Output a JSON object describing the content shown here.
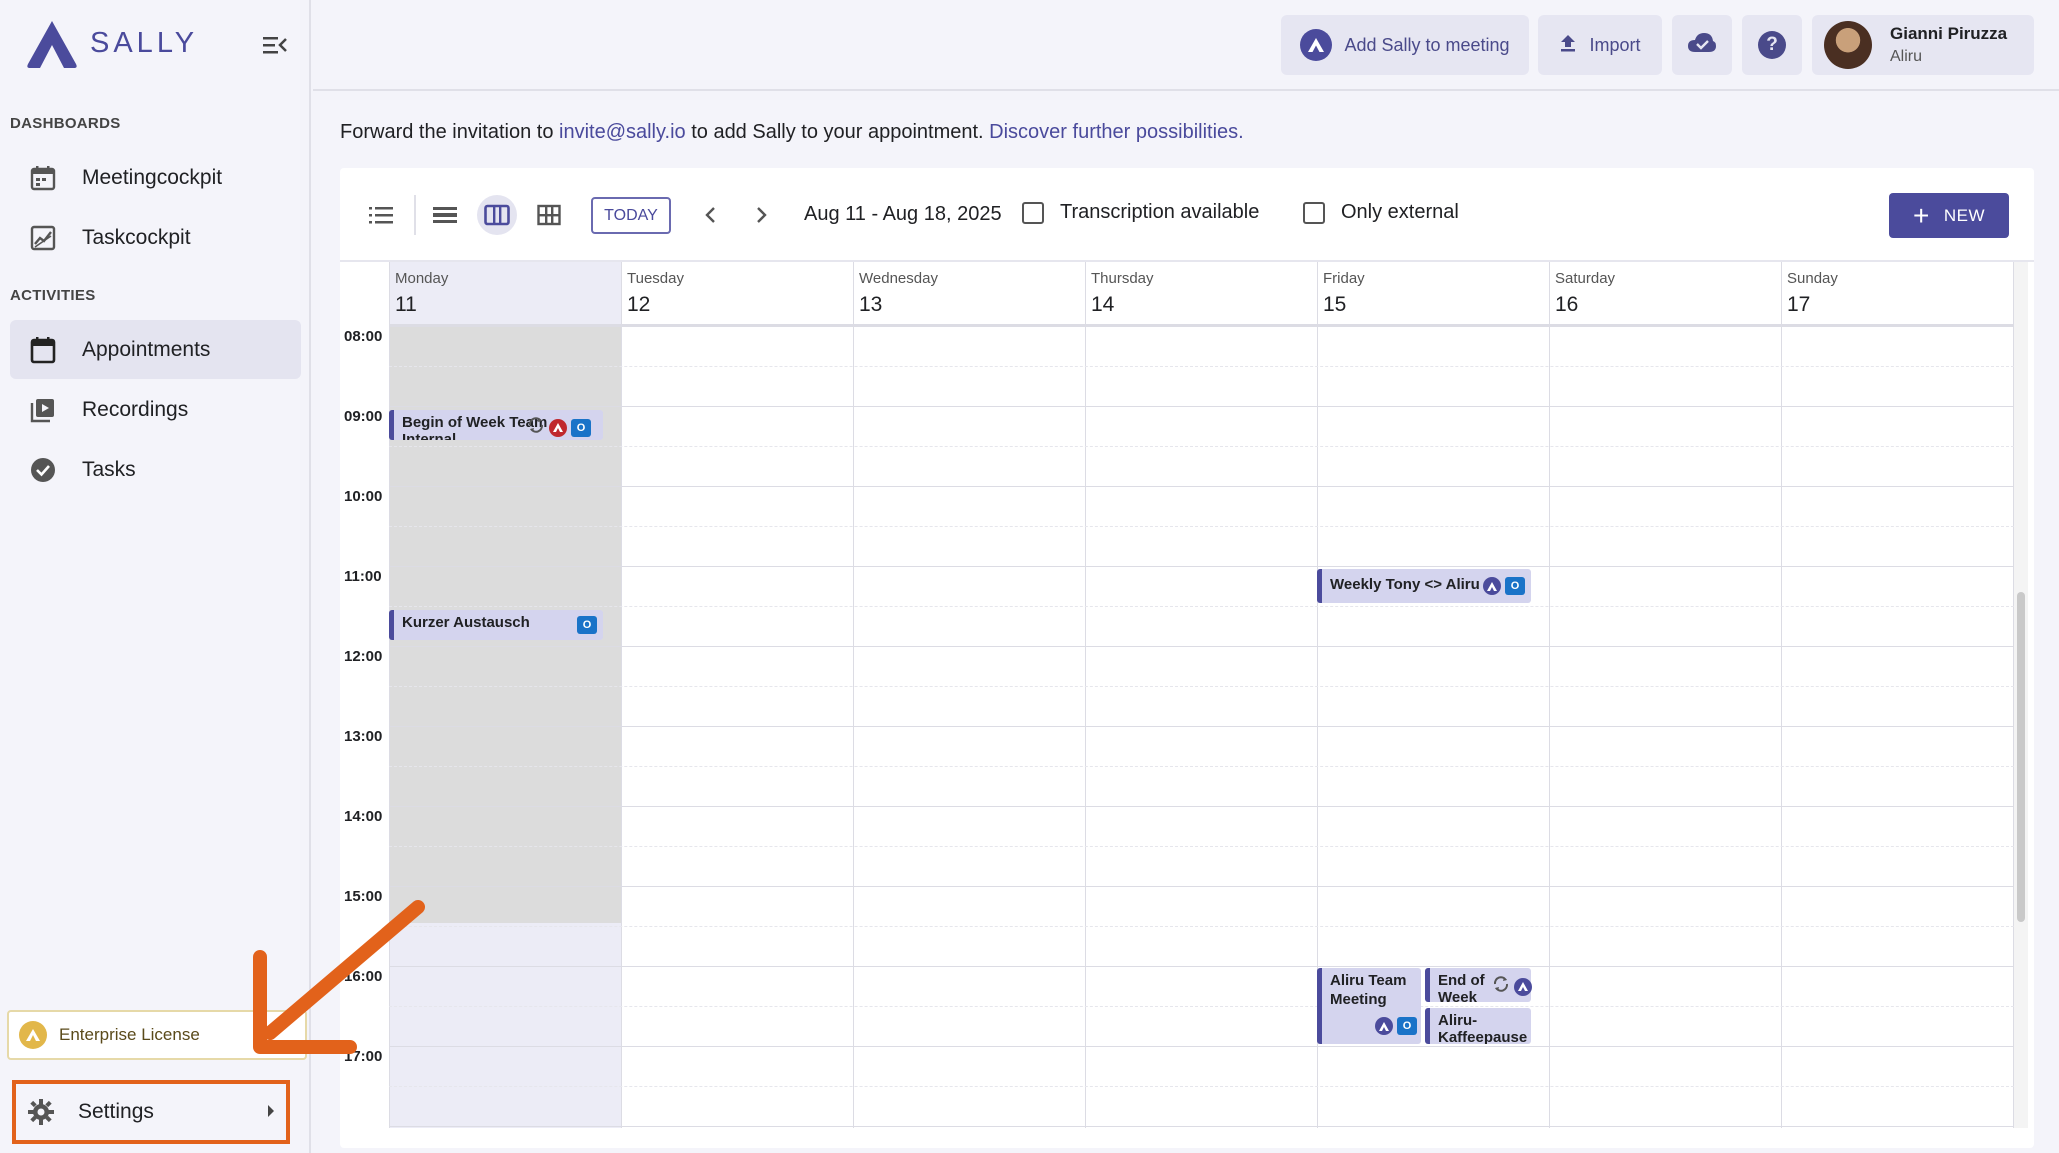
{
  "brand": {
    "name": "SALLY"
  },
  "sidebar": {
    "sections": {
      "dashboards": "DASHBOARDS",
      "activities": "ACTIVITIES"
    },
    "items": [
      {
        "label": "Meetingcockpit",
        "icon": "calendar-icon"
      },
      {
        "label": "Taskcockpit",
        "icon": "chart-icon"
      },
      {
        "label": "Appointments",
        "icon": "calendar-month-icon",
        "active": true
      },
      {
        "label": "Recordings",
        "icon": "video-library-icon"
      },
      {
        "label": "Tasks",
        "icon": "check-circle-icon"
      }
    ],
    "license": "Enterprise License",
    "settings": "Settings"
  },
  "topbar": {
    "add_sally": "Add Sally to meeting",
    "import": "Import",
    "user": {
      "name": "Gianni Piruzza",
      "org": "Aliru"
    }
  },
  "info": {
    "prefix": "Forward the invitation to",
    "email": "invite@sally.io",
    "middle": "to add Sally to your appointment.",
    "link": "Discover further possibilities."
  },
  "calendar": {
    "today": "TODAY",
    "range": "Aug 11 - Aug 18, 2025",
    "filter_transcription": "Transcription available",
    "filter_external": "Only external",
    "new": "NEW",
    "days": [
      {
        "name": "Monday",
        "num": "11"
      },
      {
        "name": "Tuesday",
        "num": "12"
      },
      {
        "name": "Wednesday",
        "num": "13"
      },
      {
        "name": "Thursday",
        "num": "14"
      },
      {
        "name": "Friday",
        "num": "15"
      },
      {
        "name": "Saturday",
        "num": "16"
      },
      {
        "name": "Sunday",
        "num": "17"
      }
    ],
    "hours": [
      "08:00",
      "09:00",
      "10:00",
      "11:00",
      "12:00",
      "13:00",
      "14:00",
      "15:00",
      "16:00",
      "17:00"
    ],
    "events": {
      "begin_of_week": "Begin of Week Team Internal",
      "kurzer": "Kurzer Austausch",
      "weekly_tony": "Weekly Tony <> Aliru",
      "aliru_team": "Aliru Team Meeting",
      "end_of_week": "End of Week",
      "aliru_kaffee": "Aliru-Kaffeepause"
    }
  }
}
